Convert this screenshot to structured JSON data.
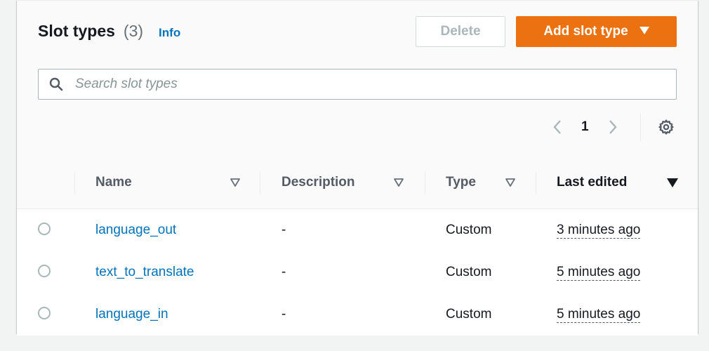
{
  "header": {
    "title": "Slot types",
    "count": "(3)",
    "info": "Info",
    "delete_label": "Delete",
    "add_label": "Add slot type"
  },
  "search": {
    "placeholder": "Search slot types",
    "value": ""
  },
  "pagination": {
    "page": "1"
  },
  "table": {
    "columns": [
      {
        "label": "Name"
      },
      {
        "label": "Description"
      },
      {
        "label": "Type"
      },
      {
        "label": "Last edited"
      }
    ],
    "rows": [
      {
        "name": "language_out",
        "description": "-",
        "type": "Custom",
        "last_edited": "3 minutes ago"
      },
      {
        "name": "text_to_translate",
        "description": "-",
        "type": "Custom",
        "last_edited": "5 minutes ago"
      },
      {
        "name": "language_in",
        "description": "-",
        "type": "Custom",
        "last_edited": "5 minutes ago"
      }
    ]
  },
  "icons": {
    "search": "search-icon",
    "prev": "chevron-left-icon",
    "next": "chevron-right-icon",
    "settings": "gear-icon",
    "sort": "sort-triangle-icon",
    "dropdown": "caret-down-icon"
  },
  "colors": {
    "primary": "#ec7211",
    "link": "#0073bb",
    "disabled": "#aab7b8"
  }
}
